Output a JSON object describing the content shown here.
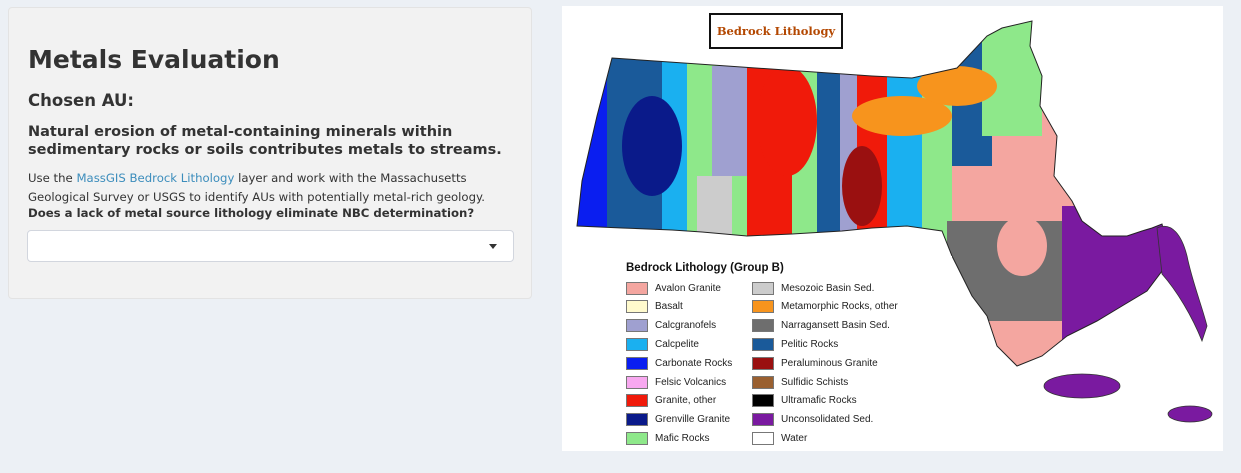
{
  "panel": {
    "title": "Metals Evaluation",
    "subtitle": "Chosen AU:",
    "description": "Natural erosion of metal-containing minerals within sedimentary rocks or soils contributes metals to streams.",
    "body_prefix": "Use the ",
    "body_link": "MassGIS Bedrock Lithology",
    "body_suffix": " layer and work with the Massachusetts Geological Survey or USGS to identify AUs with potentially metal-rich geology.",
    "question": "Does a lack of metal source lithology eliminate NBC determination?",
    "select_value": ""
  },
  "map": {
    "title": "Bedrock Lithology",
    "legend_title": "Bedrock Lithology (Group B)",
    "legend_left": [
      {
        "label": "Avalon Granite",
        "color": "#f4a6a0"
      },
      {
        "label": "Basalt",
        "color": "#fffacd"
      },
      {
        "label": "Calcgranofels",
        "color": "#9fa0d0"
      },
      {
        "label": "Calcpelite",
        "color": "#1ab0f0"
      },
      {
        "label": "Carbonate Rocks",
        "color": "#0a1ef0"
      },
      {
        "label": "Felsic Volcanics",
        "color": "#f8a8f0"
      },
      {
        "label": "Granite, other",
        "color": "#f01a0a"
      },
      {
        "label": "Grenville Granite",
        "color": "#0a1a8a"
      },
      {
        "label": "Mafic Rocks",
        "color": "#8ee88a"
      }
    ],
    "legend_right": [
      {
        "label": "Mesozoic Basin Sed.",
        "color": "#cccccc"
      },
      {
        "label": "Metamorphic Rocks, other",
        "color": "#f7941d"
      },
      {
        "label": "Narragansett Basin Sed.",
        "color": "#6e6e6e"
      },
      {
        "label": "Pelitic Rocks",
        "color": "#1a5a9a"
      },
      {
        "label": "Peraluminous Granite",
        "color": "#9a1010"
      },
      {
        "label": "Sulfidic Schists",
        "color": "#9a6030"
      },
      {
        "label": "Ultramafic Rocks",
        "color": "#000000"
      },
      {
        "label": "Unconsolidated Sed.",
        "color": "#7a1aa0"
      },
      {
        "label": "Water",
        "color": "#ffffff"
      }
    ]
  }
}
